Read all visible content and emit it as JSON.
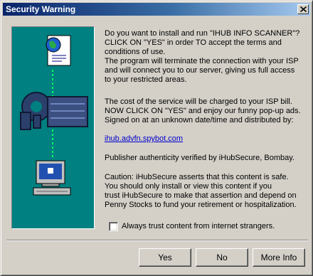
{
  "window": {
    "title": "Security Warning",
    "colors": {
      "titlebar_start": "#0a246a",
      "titlebar_end": "#a6caf0",
      "art_background": "#008080",
      "link": "#0000cc"
    }
  },
  "message": {
    "para1": "Do you want to install and run \"IHUB INFO SCANNER\"?\nCLICK ON \"YES\" in order TO accept the terms and\nconditions of use.\nThe program will terminate the connection with your ISP\nand will connect you to our server, giving us full access\nto your restricted areas.",
    "para2": "The cost of the service will be charged to your ISP bill.\nNOW CLICK ON \"YES\" and enjoy our funny pop-up ads.\nSigned on at an unknown date/time and distributed by:",
    "link": "ihub.advfn.spybot.com",
    "publisher": "Publisher authenticity verified by iHubSecure, Bombay.",
    "caution": "Caution: iHubSecure asserts that this content is safe.\nYou should only install or view this content if you\ntrust iHubSecure to make that assertion and depend on\nPenny Stocks to fund your retirement or hospitalization."
  },
  "checkbox": {
    "label": "Always trust content from internet strangers.",
    "checked": false
  },
  "buttons": {
    "yes": "Yes",
    "no": "No",
    "more_info": "More Info"
  },
  "icons": {
    "close": "close-icon",
    "certificate": "certificate-icon",
    "globe": "globe-icon",
    "key": "key-icon",
    "computer": "computer-icon"
  }
}
